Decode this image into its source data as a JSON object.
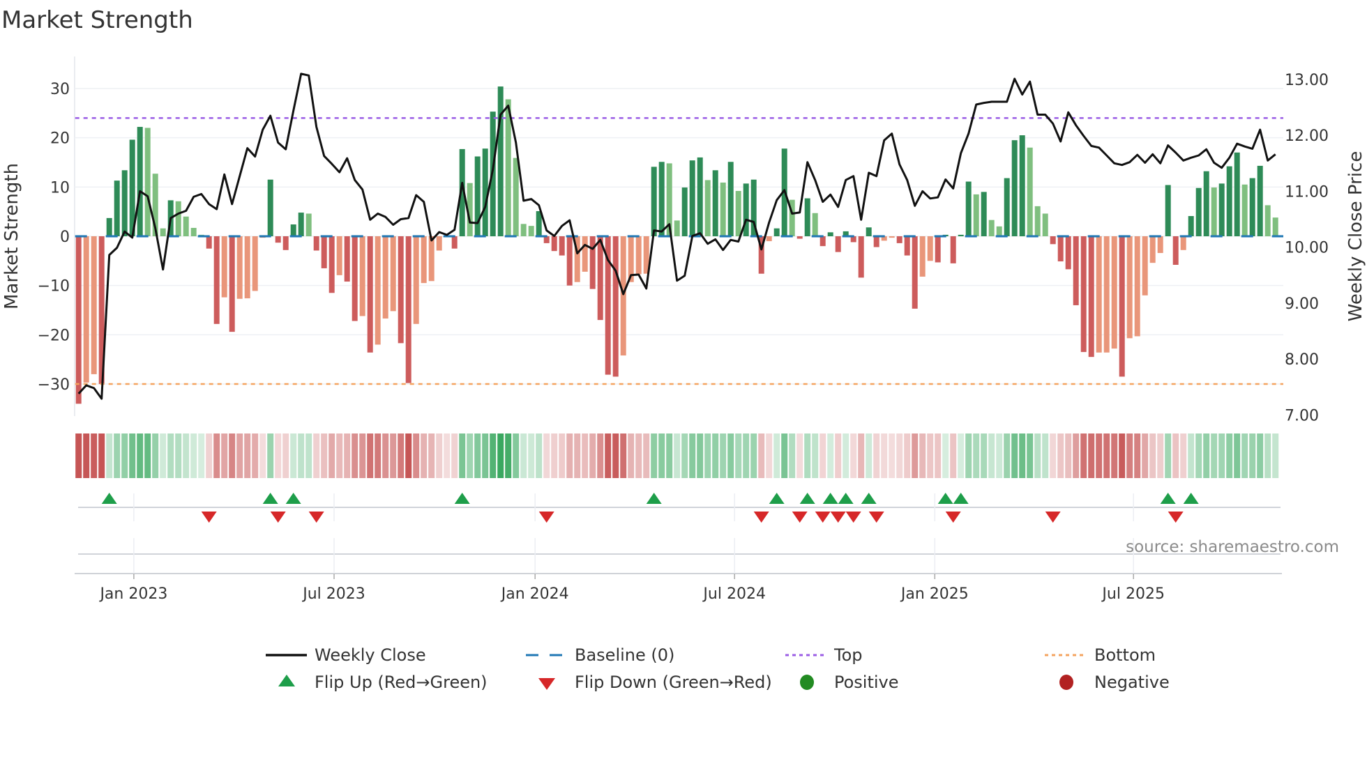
{
  "title": "Market Strength",
  "source": "source: sharemaestro.com",
  "colors": {
    "pos_strong": "#2e8b57",
    "pos_weak": "#7fbf7f",
    "neg_strong": "#cd5c5c",
    "neg_weak": "#e9967a",
    "baseline": "#1f77b4",
    "top": "#9b5de5",
    "bottom": "#f4a460",
    "flip_up": "#1e9e4a",
    "flip_down": "#d62728",
    "positive_dot": "#228b22",
    "negative_dot": "#b22222",
    "heat_pos": "#3aa860",
    "heat_neg": "#c65555"
  },
  "legend": {
    "weekly_close": "Weekly Close",
    "baseline": "Baseline (0)",
    "top": "Top",
    "bottom": "Bottom",
    "flip_up": "Flip Up (Red→Green)",
    "flip_down": "Flip Down (Green→Red)",
    "positive": "Positive",
    "negative": "Negative"
  },
  "chart_data": {
    "type": "bar",
    "title": "Market Strength",
    "ylabel": "Market Strength",
    "y2label": "Weekly Close Price",
    "ylim": [
      -36.5,
      36.5
    ],
    "y2lim": [
      6.98,
      13.41
    ],
    "yticks": [
      "30",
      "20",
      "10",
      "0",
      "−10",
      "−20",
      "−30"
    ],
    "ytick_values": [
      30,
      20,
      10,
      0,
      -10,
      -20,
      -30
    ],
    "y2ticks": [
      "13.00",
      "12.00",
      "11.00",
      "10.00",
      "9.00",
      "8.00",
      "7.00"
    ],
    "y2tick_values": [
      13,
      12,
      11,
      10,
      9,
      8,
      7
    ],
    "top_level": 24,
    "bottom_level": -30,
    "baseline": 0,
    "x_unit": "week",
    "xticks": [
      {
        "label": "Jan 2023",
        "week": 8.2
      },
      {
        "label": "Jul 2023",
        "week": 34.3
      },
      {
        "label": "Jan 2024",
        "week": 60.5
      },
      {
        "label": "Jul 2024",
        "week": 86.5
      },
      {
        "label": "Jan 2025",
        "week": 112.6
      },
      {
        "label": "Jul 2025",
        "week": 138.5
      }
    ],
    "series": [
      {
        "name": "Market Strength",
        "values": [
          -34,
          -29.7,
          -28,
          -30,
          3.7,
          11.3,
          13.4,
          19.6,
          22.2,
          22,
          12.7,
          1.6,
          7.3,
          7.1,
          4,
          1.7,
          0.3,
          -2.5,
          -17.8,
          -12.4,
          -19.4,
          -12.7,
          -12.6,
          -11.1,
          -0.3,
          11.5,
          -1.3,
          -2.8,
          2.4,
          4.8,
          4.6,
          -2.9,
          -6.5,
          -11.5,
          -7.9,
          -9.2,
          -17.2,
          -16.2,
          -23.6,
          -22,
          -16.7,
          -15.2,
          -21.7,
          -29.8,
          -17.8,
          -9.5,
          -9.1,
          -2.9,
          -0.2,
          -2.5,
          17.7,
          10.8,
          16.2,
          17.8,
          25.3,
          30.4,
          27.8,
          15.9,
          2.5,
          2.1,
          5.1,
          -1.4,
          -3,
          -3.9,
          -10,
          -9.3,
          -7.2,
          -10.7,
          -17,
          -28.1,
          -28.5,
          -24.2,
          -9.3,
          -7.7,
          -7.6,
          14.1,
          15.1,
          14.8,
          3.2,
          9.9,
          15.4,
          16,
          11.4,
          13.4,
          10.9,
          15.1,
          9.2,
          10.7,
          11.5,
          -7.6,
          -1,
          1.6,
          17.8,
          7.4,
          -0.5,
          7.7,
          4.7,
          -2,
          0.8,
          -3.2,
          1,
          -1.2,
          -8.4,
          1.8,
          -2.2,
          -0.9,
          -0.3,
          -1.4,
          -3.9,
          -14.7,
          -8.2,
          -5,
          -5.3,
          0.3,
          -5.5,
          0.3,
          11.1,
          8.5,
          9,
          3.3,
          2,
          11.8,
          19.5,
          20.5,
          18,
          6.1,
          4.6,
          -1.6,
          -5.1,
          -6.7,
          -14,
          -23.5,
          -24.5,
          -23.6,
          -23.6,
          -22.8,
          -28.5,
          -20.7,
          -20.3,
          -12,
          -5.4,
          -3.4,
          10.4,
          -5.8,
          -2.8,
          4.1,
          9.8,
          13.2,
          9.9,
          10.7,
          14.2,
          17,
          10.5,
          11.8,
          14.3,
          6.3,
          3.8
        ]
      },
      {
        "name": "Weekly Close",
        "axis": "right",
        "values": [
          7.38,
          7.53,
          7.48,
          7.29,
          9.86,
          9.99,
          10.28,
          10.17,
          11.0,
          10.91,
          10.34,
          9.6,
          10.52,
          10.6,
          10.65,
          10.9,
          10.95,
          10.77,
          10.68,
          11.3,
          10.77,
          11.27,
          11.77,
          11.62,
          12.1,
          12.35,
          11.87,
          11.75,
          12.44,
          13.1,
          13.07,
          12.15,
          11.63,
          11.49,
          11.34,
          11.59,
          11.2,
          11.03,
          10.49,
          10.6,
          10.54,
          10.4,
          10.5,
          10.52,
          10.93,
          10.81,
          10.12,
          10.27,
          10.22,
          10.31,
          11.15,
          10.44,
          10.43,
          10.72,
          11.39,
          12.37,
          12.53,
          11.87,
          10.83,
          10.86,
          10.75,
          10.3,
          10.2,
          10.38,
          10.48,
          9.89,
          10.04,
          9.97,
          10.13,
          9.77,
          9.58,
          9.16,
          9.5,
          9.51,
          9.26,
          10.3,
          10.28,
          10.41,
          9.4,
          9.49,
          10.2,
          10.25,
          10.06,
          10.14,
          9.95,
          10.13,
          10.1,
          10.49,
          10.45,
          9.96,
          10.44,
          10.84,
          11.02,
          10.6,
          10.62,
          11.52,
          11.2,
          10.81,
          10.94,
          10.72,
          11.2,
          11.27,
          10.49,
          11.33,
          11.27,
          11.91,
          12.03,
          11.48,
          11.2,
          10.74,
          11.0,
          10.87,
          10.89,
          11.21,
          11.05,
          11.68,
          12.03,
          12.55,
          12.58,
          12.6,
          12.6,
          12.6,
          13.01,
          12.73,
          12.96,
          12.37,
          12.37,
          12.21,
          11.89,
          12.41,
          12.18,
          11.99,
          11.81,
          11.78,
          11.64,
          11.5,
          11.47,
          11.52,
          11.65,
          11.51,
          11.66,
          11.5,
          11.82,
          11.69,
          11.55,
          11.6,
          11.64,
          11.75,
          11.51,
          11.42,
          11.6,
          11.85,
          11.8,
          11.76,
          12.1,
          11.55,
          11.66
        ]
      }
    ],
    "legend_position": "bottom"
  }
}
